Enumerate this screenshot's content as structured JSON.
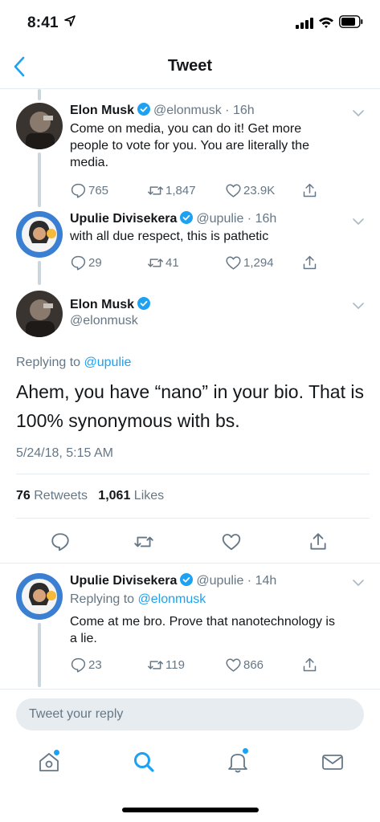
{
  "status_bar": {
    "time": "8:41"
  },
  "nav": {
    "title": "Tweet"
  },
  "thread": [
    {
      "name": "Elon Musk",
      "handle": "@elonmusk",
      "time": "16h",
      "text": "Come on media, you can do it! Get more people to vote for you. You are literally the media.",
      "replies": "765",
      "retweets": "1,847",
      "likes": "23.9K"
    },
    {
      "name": "Upulie Divisekera",
      "handle": "@upulie",
      "time": "16h",
      "text": "with all due respect, this is pathetic",
      "replies": "29",
      "retweets": "41",
      "likes": "1,294"
    }
  ],
  "main_tweet": {
    "name": "Elon Musk",
    "handle": "@elonmusk",
    "replying_prefix": "Replying to",
    "replying_to": "@upulie",
    "text": "Ahem, you have “nano” in your bio. That is 100% synonymous with bs.",
    "date": "5/24/18, 5:15 AM",
    "retweet_count": "76",
    "retweet_label": "Retweets",
    "like_count": "1,061",
    "like_label": "Likes"
  },
  "reply_tweet": {
    "name": "Upulie Divisekera",
    "handle": "@upulie",
    "time": "14h",
    "replying_prefix": "Replying to",
    "replying_to": "@elonmusk",
    "text": "Come at me bro. Prove that nanotechnology is a lie.",
    "replies": "23",
    "retweets": "119",
    "likes": "866"
  },
  "reply_box": {
    "placeholder": "Tweet your reply"
  },
  "colors": {
    "accent": "#1da1f2",
    "text": "#14171a",
    "secondary": "#657786",
    "border": "#e6ecf0"
  },
  "icons": [
    "chevron-left-icon",
    "verified-badge-icon",
    "caret-down-icon",
    "reply-icon",
    "retweet-icon",
    "like-icon",
    "share-icon",
    "home-icon",
    "search-icon",
    "notifications-icon",
    "messages-icon"
  ]
}
